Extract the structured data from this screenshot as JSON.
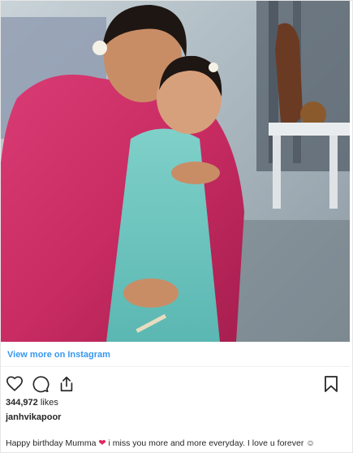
{
  "post": {
    "photo_alt": "",
    "view_more_label": "View more on Instagram",
    "likes_count": "344,972",
    "likes_suffix": "likes",
    "username": "janhvikapoor",
    "caption": {
      "part1": "Happy birthday Mumma",
      "emoji": "❤",
      "part2": "i miss you more and more everyday. I love u forever",
      "trailing_emoji": "☺"
    }
  },
  "icons": {
    "like": "heart-icon",
    "comment": "comment-icon",
    "share": "share-icon",
    "save": "bookmark-icon"
  },
  "colors": {
    "link": "#3897f0",
    "text": "#262626",
    "heart": "#e0245e",
    "divider": "#efefef"
  }
}
